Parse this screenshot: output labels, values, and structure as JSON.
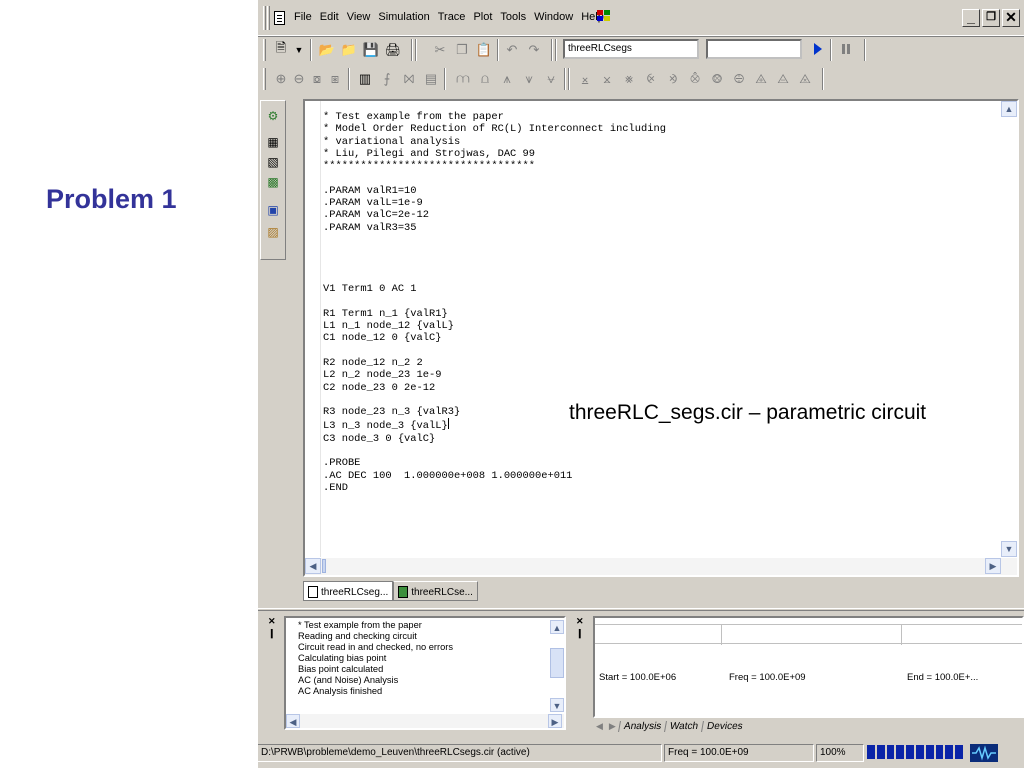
{
  "slide": {
    "title": "Problem 1",
    "annotation": "threeRLC_segs.cir – parametric circuit"
  },
  "menubar": {
    "items": [
      "File",
      "Edit",
      "View",
      "Simulation",
      "Trace",
      "Plot",
      "Tools",
      "Window",
      "Help"
    ],
    "window_buttons": [
      "_",
      "0",
      "X"
    ]
  },
  "toolbar": {
    "profile_combo": "threeRLCsegs",
    "second_combo": ""
  },
  "editor": {
    "lines_before_caret": "* Test example from the paper\n* Model Order Reduction of RC(L) Interconnect including\n* variational analysis\n* Liu, Pilegi and Strojwas, DAC 99\n**********************************\n\n.PARAM valR1=10\n.PARAM valL=1e-9\n.PARAM valC=2e-12\n.PARAM valR3=35\n\n\n\n\nV1 Term1 0 AC 1\n\nR1 Term1 n_1 {valR1}\nL1 n_1 node_12 {valL}\nC1 node_12 0 {valC}\n\nR2 node_12 n_2 2\nL2 n_2 node_23 1e-9\nC2 node_23 0 2e-12\n\nR3 node_23 n_3 {valR3}\nL3 n_3 node_3 {valL}",
    "lines_after_caret": "\nC3 node_3 0 {valC}\n\n.PROBE\n.AC DEC 100  1.000000e+008 1.000000e+011\n.END"
  },
  "doc_tabs": [
    "threeRLCseg...",
    "threeRLCse..."
  ],
  "output": {
    "lines": "* Test example from the paper\nReading and checking circuit\nCircuit read in and checked, no errors\nCalculating bias point\nBias point calculated\nAC (and Noise) Analysis\nAC Analysis finished"
  },
  "probe": {
    "start": "Start = 100.0E+06",
    "freq": "Freq = 100.0E+09",
    "end": "End = 100.0E+...",
    "tabs": [
      "Analysis",
      "Watch",
      "Devices"
    ]
  },
  "statusbar": {
    "path": "D:\\PRWB\\probleme\\demo_Leuven\\threeRLCsegs.cir (active)",
    "freq": "Freq = 100.0E+09",
    "zoom": "100%",
    "progress_fraction": 1.0
  },
  "colors": {
    "title": "#333399",
    "progress": "#0a24a8",
    "window_face": "#d4d0c8"
  }
}
